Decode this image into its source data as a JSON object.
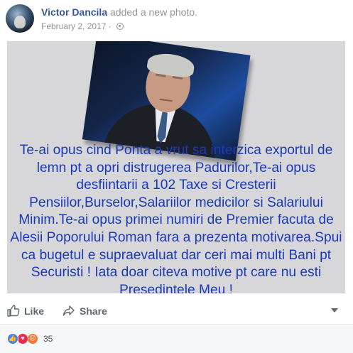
{
  "post": {
    "author": "Victor Dancila",
    "action": "added a new photo.",
    "date": "February 2, 2017",
    "date_separator": "·",
    "privacy_icon": "globe-icon"
  },
  "photo": {
    "caption": "Te-ai opus cind Ponta a vrut sa interzica exportul de lemn pt a opri distrugerea Padurilor,Te-ai opus desfiintarii a 102 Taxe si Cresterii Pensiilor,Burselor,Salariilor medicilor si Salariului Minim.Te-ai opus primei numiri de Premier facuta de Alesii Poporului Roman fara a prezenta motivarea.Spui ca bugetul e supraevaluat dar ceri mai multi Bani pt Securisti ! Iata doar citeva motive pt care nu esti Presedintele Meu !",
    "caption_color": "#1b39b8"
  },
  "actions": {
    "like_label": "Like",
    "share_label": "Share"
  },
  "reactions": {
    "icons": [
      "like-icon",
      "love-icon",
      "angry-icon"
    ],
    "count": "35"
  },
  "colors": {
    "link": "#365899",
    "muted": "#90949c",
    "photo_bg": "#d7d7d9"
  }
}
